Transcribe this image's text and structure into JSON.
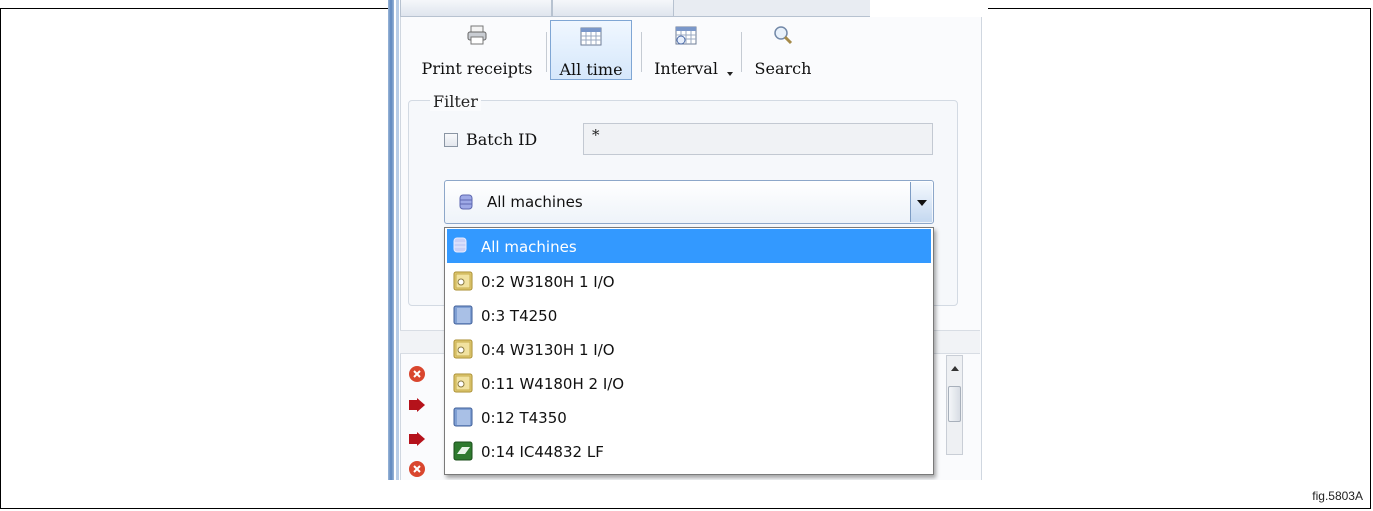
{
  "toolbar": {
    "print_receipts": "Print receipts",
    "all_time": "All time",
    "interval": "Interval",
    "search": "Search"
  },
  "filter": {
    "title": "Filter",
    "batch_id_label": "Batch ID",
    "batch_id_value": "*",
    "batch_id_checked": false,
    "machine_selected": "All machines"
  },
  "dropdown": {
    "items": [
      {
        "label": "All machines",
        "icon": "database-icon",
        "selected": true
      },
      {
        "label": "0:2 W3180H 1 I/O",
        "icon": "washer-icon"
      },
      {
        "label": "0:3 T4250",
        "icon": "dryer-icon"
      },
      {
        "label": "0:4 W3130H 1 I/O",
        "icon": "washer-icon"
      },
      {
        "label": "0:11 W4180H 2 I/O",
        "icon": "washer-icon"
      },
      {
        "label": "0:12 T4350",
        "icon": "dryer-icon"
      },
      {
        "label": "0:14 IC44832 LF",
        "icon": "ironer-icon"
      }
    ]
  },
  "figure_label": "fig.5803A"
}
